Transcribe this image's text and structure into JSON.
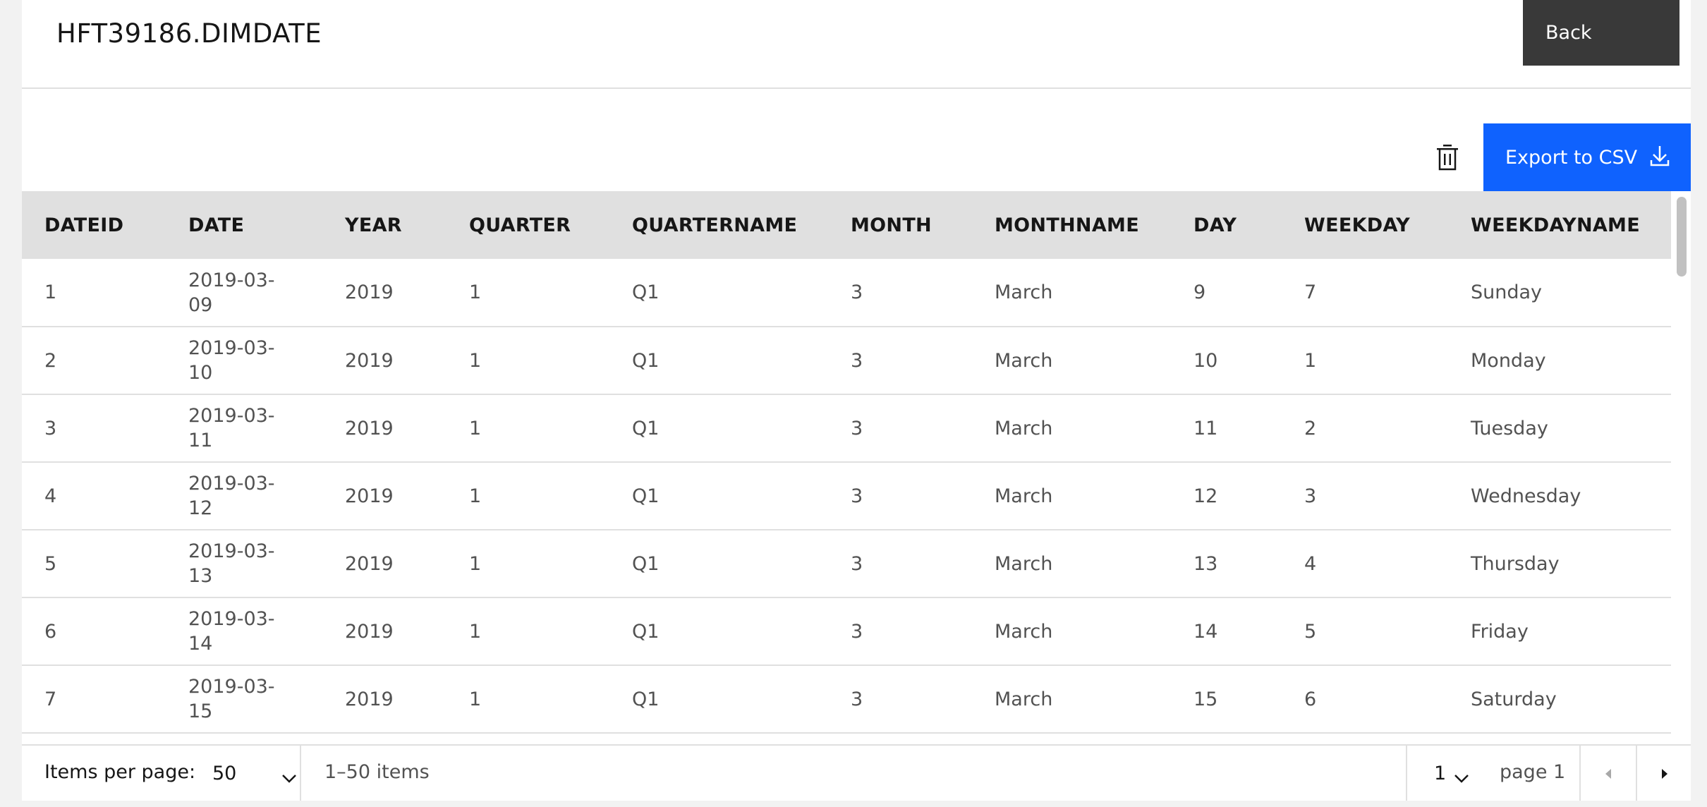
{
  "header": {
    "title": "HFT39186.DIMDATE",
    "back_label": "Back"
  },
  "toolbar": {
    "export_label": "Export to CSV",
    "delete_icon": "trash-icon",
    "export_icon": "download-icon"
  },
  "table": {
    "columns": [
      "DATEID",
      "DATE",
      "YEAR",
      "QUARTER",
      "QUARTERNAME",
      "MONTH",
      "MONTHNAME",
      "DAY",
      "WEEKDAY",
      "WEEKDAYNAME"
    ],
    "rows": [
      [
        "1",
        "2019-03-09",
        "2019",
        "1",
        "Q1",
        "3",
        "March",
        "9",
        "7",
        "Sunday"
      ],
      [
        "2",
        "2019-03-10",
        "2019",
        "1",
        "Q1",
        "3",
        "March",
        "10",
        "1",
        "Monday"
      ],
      [
        "3",
        "2019-03-11",
        "2019",
        "1",
        "Q1",
        "3",
        "March",
        "11",
        "2",
        "Tuesday"
      ],
      [
        "4",
        "2019-03-12",
        "2019",
        "1",
        "Q1",
        "3",
        "March",
        "12",
        "3",
        "Wednesday"
      ],
      [
        "5",
        "2019-03-13",
        "2019",
        "1",
        "Q1",
        "3",
        "March",
        "13",
        "4",
        "Thursday"
      ],
      [
        "6",
        "2019-03-14",
        "2019",
        "1",
        "Q1",
        "3",
        "March",
        "14",
        "5",
        "Friday"
      ],
      [
        "7",
        "2019-03-15",
        "2019",
        "1",
        "Q1",
        "3",
        "March",
        "15",
        "6",
        "Saturday"
      ]
    ]
  },
  "pagination": {
    "items_per_page_label": "Items per page:",
    "items_per_page_value": "50",
    "item_range": "1–50 items",
    "page_value": "1",
    "page_label": "page 1"
  }
}
